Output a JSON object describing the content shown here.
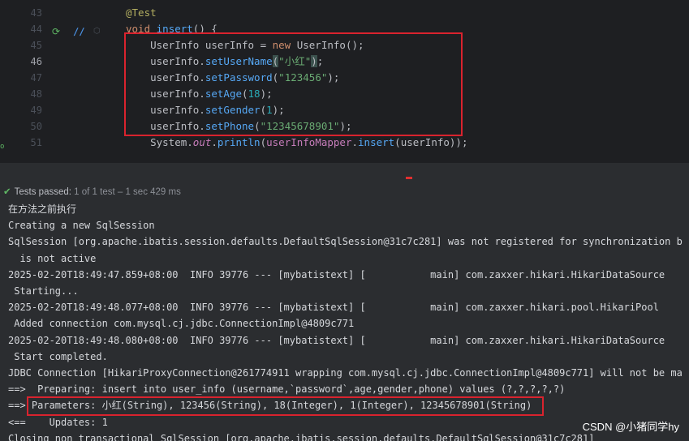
{
  "editor": {
    "lines": [
      {
        "num": "43",
        "segments": [
          {
            "t": "@Test",
            "c": "ann"
          }
        ]
      },
      {
        "num": "44",
        "segments": [
          {
            "t": "void ",
            "c": "kw"
          },
          {
            "t": "insert",
            "c": "fn"
          },
          {
            "t": "() {",
            "c": ""
          }
        ]
      },
      {
        "num": "45",
        "segments": [
          {
            "t": "    UserInfo userInfo = ",
            "c": ""
          },
          {
            "t": "new ",
            "c": "kw"
          },
          {
            "t": "UserInfo();",
            "c": ""
          }
        ]
      },
      {
        "num": "46",
        "segments": [
          {
            "t": "    userInfo.",
            "c": ""
          },
          {
            "t": "setUserName",
            "c": "fn"
          },
          {
            "t": "(",
            "c": "paren-hl"
          },
          {
            "t": "\"小红\"",
            "c": "str"
          },
          {
            "t": ")",
            "c": "paren-hl"
          },
          {
            "t": ";",
            "c": ""
          }
        ]
      },
      {
        "num": "47",
        "segments": [
          {
            "t": "    userInfo.",
            "c": ""
          },
          {
            "t": "setPassword",
            "c": "fn"
          },
          {
            "t": "(",
            "c": ""
          },
          {
            "t": "\"123456\"",
            "c": "str"
          },
          {
            "t": ");",
            "c": ""
          }
        ]
      },
      {
        "num": "48",
        "segments": [
          {
            "t": "    userInfo.",
            "c": ""
          },
          {
            "t": "setAge",
            "c": "fn"
          },
          {
            "t": "(",
            "c": ""
          },
          {
            "t": "18",
            "c": "num"
          },
          {
            "t": ");",
            "c": ""
          }
        ]
      },
      {
        "num": "49",
        "segments": [
          {
            "t": "    userInfo.",
            "c": ""
          },
          {
            "t": "setGender",
            "c": "fn"
          },
          {
            "t": "(",
            "c": ""
          },
          {
            "t": "1",
            "c": "num"
          },
          {
            "t": ");",
            "c": ""
          }
        ]
      },
      {
        "num": "50",
        "segments": [
          {
            "t": "    userInfo.",
            "c": ""
          },
          {
            "t": "setPhone",
            "c": "fn"
          },
          {
            "t": "(",
            "c": ""
          },
          {
            "t": "\"12345678901\"",
            "c": "str"
          },
          {
            "t": ");",
            "c": ""
          }
        ]
      },
      {
        "num": "51",
        "segments": [
          {
            "t": "    System.",
            "c": ""
          },
          {
            "t": "out",
            "c": "italic"
          },
          {
            "t": ".",
            "c": ""
          },
          {
            "t": "println",
            "c": "fn"
          },
          {
            "t": "(",
            "c": ""
          },
          {
            "t": "userInfoMapper",
            "c": "field"
          },
          {
            "t": ".",
            "c": ""
          },
          {
            "t": "insert",
            "c": "fn"
          },
          {
            "t": "(userInfo));",
            "c": ""
          }
        ]
      }
    ],
    "current_line": "46"
  },
  "test_status": {
    "passed_label": "Tests passed:",
    "summary": "1 of 1 test – 1 sec 429 ms"
  },
  "console": {
    "lines": [
      "在方法之前执行",
      "Creating a new SqlSession",
      "SqlSession [org.apache.ibatis.session.defaults.DefaultSqlSession@31c7c281] was not registered for synchronization b",
      "  is not active",
      "2025-02-20T18:49:47.859+08:00  INFO 39776 --- [mybatistext] [           main] com.zaxxer.hikari.HikariDataSource",
      " Starting...",
      "2025-02-20T18:49:48.077+08:00  INFO 39776 --- [mybatistext] [           main] com.zaxxer.hikari.pool.HikariPool",
      " Added connection com.mysql.cj.jdbc.ConnectionImpl@4809c771",
      "2025-02-20T18:49:48.080+08:00  INFO 39776 --- [mybatistext] [           main] com.zaxxer.hikari.HikariDataSource",
      " Start completed.",
      "JDBC Connection [HikariProxyConnection@261774911 wrapping com.mysql.cj.jdbc.ConnectionImpl@4809c771] will not be ma",
      "==>  Preparing: insert into user_info (username,`password`,age,gender,phone) values (?,?,?,?,?)",
      "==> Parameters: 小红(String), 123456(String), 18(Integer), 1(Integer), 12345678901(String)",
      "<==    Updates: 1",
      "Closing non transactional SqlSession [org.apache.ibatis.session.defaults.DefaultSqlSession@31c7c281]"
    ]
  },
  "watermark": "CSDN @小猪同学hy",
  "colors": {
    "highlight_box": "#d9232e",
    "pass_green": "#5fb865"
  }
}
